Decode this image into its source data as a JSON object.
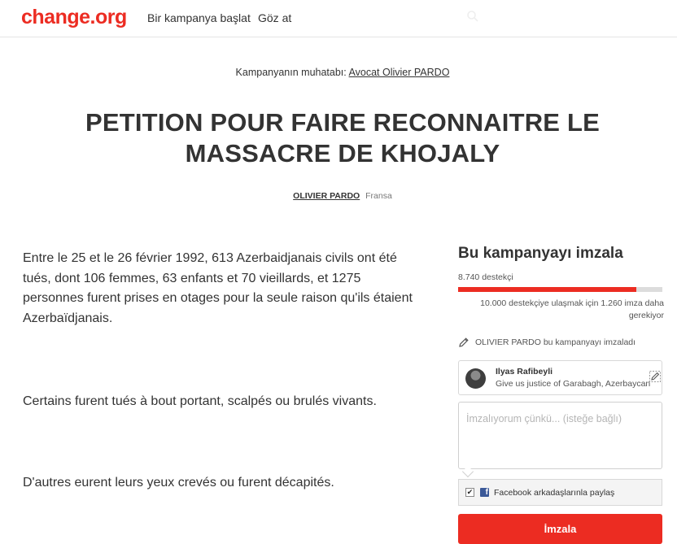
{
  "header": {
    "logo": "change.org",
    "nav": {
      "start_petition": "Bir kampanya başlat",
      "browse": "Göz at"
    }
  },
  "petition": {
    "target_prefix": "Kampanyanın muhatabı:",
    "target_name": "Avocat Olivier PARDO",
    "title": "PETITION POUR FAIRE RECONNAITRE LE MASSACRE DE KHOJALY",
    "author_name": "OLIVIER PARDO",
    "author_location": "Fransa",
    "paragraphs": [
      "Entre le 25 et le 26 février 1992, 613 Azerbaidjanais civils ont été tués, dont 106 femmes, 63 enfants et 70 vieillards, et 1275 personnes furent prises en otages pour la seule raison qu'ils étaient Azerbaïdjanais.",
      "Certains furent tués à bout portant, scalpés ou brulés vivants.",
      "D'autres eurent leurs yeux crevés ou furent décapités."
    ]
  },
  "sign_panel": {
    "title": "Bu kampanyayı imzala",
    "supporters": "8.740 destekçi",
    "progress_fraction": 0.874,
    "goal_note": "10.000 destekçiye ulaşmak için 1.260 imza daha gerekiyor",
    "signed_notice": "OLIVIER PARDO bu kampanyayı imzaladı",
    "recent_signer": {
      "name": "Ilyas Rafibeyli",
      "comment": "Give us justice of Garabagh, Azerbaycan"
    },
    "reason_placeholder": "İmzalıyorum çünkü... (isteğe bağlı)",
    "share_checked": true,
    "share_label": "Facebook arkadaşlarınla paylaş",
    "sign_button": "İmzala",
    "accent_color": "#ec2c22"
  }
}
